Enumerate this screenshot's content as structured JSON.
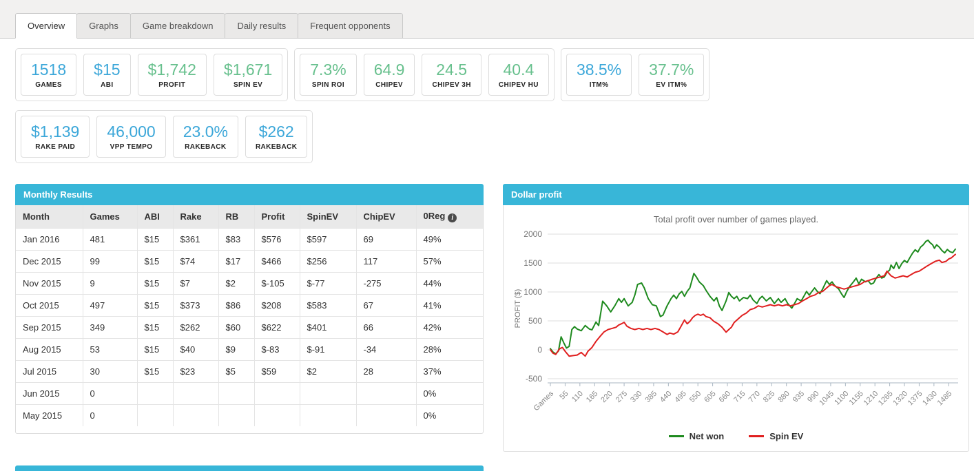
{
  "colors": {
    "accent": "#38b6d8",
    "stat_blue": "#3ca7d9",
    "stat_green": "#67c08d",
    "net_won_green": "#1e8a1e",
    "spin_ev_red": "#e01f1f"
  },
  "tabs": [
    {
      "label": "Overview",
      "active": true
    },
    {
      "label": "Graphs",
      "active": false
    },
    {
      "label": "Game breakdown",
      "active": false
    },
    {
      "label": "Daily results",
      "active": false
    },
    {
      "label": "Frequent opponents",
      "active": false
    }
  ],
  "stat_rows": [
    [
      {
        "stats": [
          {
            "value": "1518",
            "label": "GAMES",
            "color": "blue"
          },
          {
            "value": "$15",
            "label": "ABI",
            "color": "blue"
          },
          {
            "value": "$1,742",
            "label": "PROFIT",
            "color": "green"
          },
          {
            "value": "$1,671",
            "label": "SPIN EV",
            "color": "green"
          }
        ]
      },
      {
        "stats": [
          {
            "value": "7.3%",
            "label": "SPIN ROI",
            "color": "green"
          },
          {
            "value": "64.9",
            "label": "CHIPEV",
            "color": "green"
          },
          {
            "value": "24.5",
            "label": "CHIPEV 3H",
            "color": "green"
          },
          {
            "value": "40.4",
            "label": "CHIPEV HU",
            "color": "green"
          }
        ]
      },
      {
        "stats": [
          {
            "value": "38.5%",
            "label": "ITM%",
            "color": "blue"
          },
          {
            "value": "37.7%",
            "label": "EV ITM%",
            "color": "green"
          }
        ]
      }
    ],
    [
      {
        "stats": [
          {
            "value": "$1,139",
            "label": "RAKE PAID",
            "color": "blue"
          },
          {
            "value": "46,000",
            "label": "VPP TEMPO",
            "color": "blue"
          },
          {
            "value": "23.0%",
            "label": "RAKEBACK",
            "color": "blue"
          },
          {
            "value": "$262",
            "label": "RAKEBACK",
            "color": "blue"
          }
        ]
      }
    ]
  ],
  "monthly_results": {
    "title": "Monthly Results",
    "columns": [
      "Month",
      "Games",
      "ABI",
      "Rake",
      "RB",
      "Profit",
      "SpinEV",
      "ChipEV",
      "0Reg"
    ],
    "info_icon_column": "0Reg",
    "info_icon_glyph": "i",
    "rows": [
      [
        "Jan 2016",
        "481",
        "$15",
        "$361",
        "$83",
        "$576",
        "$597",
        "69",
        "49%"
      ],
      [
        "Dec 2015",
        "99",
        "$15",
        "$74",
        "$17",
        "$466",
        "$256",
        "117",
        "57%"
      ],
      [
        "Nov 2015",
        "9",
        "$15",
        "$7",
        "$2",
        "$-105",
        "$-77",
        "-275",
        "44%"
      ],
      [
        "Oct 2015",
        "497",
        "$15",
        "$373",
        "$86",
        "$208",
        "$583",
        "67",
        "41%"
      ],
      [
        "Sep 2015",
        "349",
        "$15",
        "$262",
        "$60",
        "$622",
        "$401",
        "66",
        "42%"
      ],
      [
        "Aug 2015",
        "53",
        "$15",
        "$40",
        "$9",
        "$-83",
        "$-91",
        "-34",
        "28%"
      ],
      [
        "Jul 2015",
        "30",
        "$15",
        "$23",
        "$5",
        "$59",
        "$2",
        "28",
        "37%"
      ],
      [
        "Jun 2015",
        "0",
        "",
        "",
        "",
        "",
        "",
        "",
        "0%"
      ],
      [
        "May 2015",
        "0",
        "",
        "",
        "",
        "",
        "",
        "",
        "0%"
      ]
    ]
  },
  "chart_data": {
    "type": "line",
    "title": "Dollar profit",
    "subtitle": "Total profit over number of games played.",
    "xlabel": "Games",
    "ylabel": "PROFIT ($)",
    "ylim": [
      -500,
      2000
    ],
    "xlim": [
      0,
      1510
    ],
    "grid": true,
    "legend_position": "bottom",
    "yticks": [
      2000,
      1500,
      1000,
      500,
      0,
      -500
    ],
    "xticks": [
      55,
      110,
      165,
      220,
      275,
      330,
      385,
      440,
      495,
      550,
      605,
      660,
      715,
      770,
      825,
      880,
      935,
      990,
      1045,
      1100,
      1155,
      1210,
      1265,
      1320,
      1375,
      1430,
      1485
    ],
    "series": [
      {
        "name": "Net won",
        "color": "#1e8a1e",
        "points": [
          [
            0,
            20
          ],
          [
            10,
            -40
          ],
          [
            20,
            -70
          ],
          [
            30,
            -20
          ],
          [
            40,
            225
          ],
          [
            50,
            120
          ],
          [
            60,
            30
          ],
          [
            70,
            60
          ],
          [
            80,
            350
          ],
          [
            90,
            400
          ],
          [
            100,
            360
          ],
          [
            115,
            330
          ],
          [
            130,
            420
          ],
          [
            145,
            360
          ],
          [
            155,
            345
          ],
          [
            170,
            480
          ],
          [
            180,
            420
          ],
          [
            195,
            840
          ],
          [
            210,
            760
          ],
          [
            225,
            655
          ],
          [
            240,
            760
          ],
          [
            255,
            885
          ],
          [
            265,
            820
          ],
          [
            275,
            885
          ],
          [
            290,
            760
          ],
          [
            305,
            820
          ],
          [
            315,
            950
          ],
          [
            325,
            1130
          ],
          [
            340,
            1155
          ],
          [
            350,
            1070
          ],
          [
            365,
            885
          ],
          [
            380,
            780
          ],
          [
            395,
            760
          ],
          [
            410,
            575
          ],
          [
            420,
            600
          ],
          [
            435,
            760
          ],
          [
            450,
            885
          ],
          [
            460,
            945
          ],
          [
            470,
            885
          ],
          [
            480,
            965
          ],
          [
            490,
            1010
          ],
          [
            500,
            925
          ],
          [
            510,
            1010
          ],
          [
            520,
            1070
          ],
          [
            535,
            1320
          ],
          [
            545,
            1255
          ],
          [
            555,
            1175
          ],
          [
            570,
            1110
          ],
          [
            580,
            1030
          ],
          [
            595,
            925
          ],
          [
            610,
            845
          ],
          [
            620,
            905
          ],
          [
            630,
            760
          ],
          [
            640,
            680
          ],
          [
            655,
            845
          ],
          [
            665,
            990
          ],
          [
            675,
            925
          ],
          [
            685,
            885
          ],
          [
            695,
            925
          ],
          [
            705,
            845
          ],
          [
            720,
            905
          ],
          [
            735,
            885
          ],
          [
            745,
            945
          ],
          [
            755,
            865
          ],
          [
            770,
            800
          ],
          [
            780,
            885
          ],
          [
            790,
            925
          ],
          [
            805,
            845
          ],
          [
            820,
            905
          ],
          [
            835,
            800
          ],
          [
            850,
            885
          ],
          [
            860,
            820
          ],
          [
            875,
            885
          ],
          [
            885,
            800
          ],
          [
            900,
            720
          ],
          [
            910,
            800
          ],
          [
            920,
            885
          ],
          [
            935,
            845
          ],
          [
            945,
            925
          ],
          [
            955,
            1010
          ],
          [
            965,
            945
          ],
          [
            975,
            1010
          ],
          [
            985,
            1070
          ],
          [
            995,
            1010
          ],
          [
            1005,
            970
          ],
          [
            1015,
            1050
          ],
          [
            1030,
            1195
          ],
          [
            1040,
            1130
          ],
          [
            1050,
            1175
          ],
          [
            1060,
            1110
          ],
          [
            1075,
            1050
          ],
          [
            1085,
            970
          ],
          [
            1095,
            905
          ],
          [
            1105,
            1010
          ],
          [
            1115,
            1090
          ],
          [
            1130,
            1175
          ],
          [
            1140,
            1240
          ],
          [
            1150,
            1140
          ],
          [
            1160,
            1220
          ],
          [
            1175,
            1175
          ],
          [
            1185,
            1195
          ],
          [
            1195,
            1135
          ],
          [
            1205,
            1155
          ],
          [
            1215,
            1240
          ],
          [
            1225,
            1300
          ],
          [
            1235,
            1240
          ],
          [
            1245,
            1260
          ],
          [
            1255,
            1340
          ],
          [
            1265,
            1380
          ],
          [
            1270,
            1465
          ],
          [
            1280,
            1405
          ],
          [
            1290,
            1510
          ],
          [
            1300,
            1405
          ],
          [
            1310,
            1490
          ],
          [
            1320,
            1545
          ],
          [
            1330,
            1510
          ],
          [
            1340,
            1590
          ],
          [
            1350,
            1670
          ],
          [
            1360,
            1730
          ],
          [
            1370,
            1690
          ],
          [
            1380,
            1775
          ],
          [
            1390,
            1815
          ],
          [
            1400,
            1875
          ],
          [
            1408,
            1895
          ],
          [
            1415,
            1855
          ],
          [
            1425,
            1815
          ],
          [
            1432,
            1755
          ],
          [
            1440,
            1815
          ],
          [
            1450,
            1775
          ],
          [
            1460,
            1715
          ],
          [
            1470,
            1675
          ],
          [
            1480,
            1735
          ],
          [
            1490,
            1695
          ],
          [
            1500,
            1680
          ],
          [
            1510,
            1740
          ]
        ]
      },
      {
        "name": "Spin EV",
        "color": "#e01f1f",
        "points": [
          [
            0,
            0
          ],
          [
            10,
            -60
          ],
          [
            20,
            -80
          ],
          [
            35,
            20
          ],
          [
            45,
            40
          ],
          [
            55,
            -25
          ],
          [
            70,
            -110
          ],
          [
            85,
            -100
          ],
          [
            100,
            -90
          ],
          [
            115,
            -45
          ],
          [
            130,
            -110
          ],
          [
            140,
            -25
          ],
          [
            155,
            40
          ],
          [
            170,
            145
          ],
          [
            185,
            230
          ],
          [
            200,
            310
          ],
          [
            215,
            350
          ],
          [
            230,
            370
          ],
          [
            245,
            390
          ],
          [
            255,
            430
          ],
          [
            265,
            450
          ],
          [
            275,
            475
          ],
          [
            285,
            410
          ],
          [
            300,
            370
          ],
          [
            315,
            350
          ],
          [
            330,
            370
          ],
          [
            345,
            350
          ],
          [
            360,
            370
          ],
          [
            375,
            350
          ],
          [
            390,
            370
          ],
          [
            405,
            350
          ],
          [
            420,
            310
          ],
          [
            435,
            265
          ],
          [
            445,
            290
          ],
          [
            460,
            270
          ],
          [
            475,
            310
          ],
          [
            485,
            390
          ],
          [
            500,
            515
          ],
          [
            510,
            450
          ],
          [
            520,
            490
          ],
          [
            530,
            555
          ],
          [
            540,
            595
          ],
          [
            550,
            615
          ],
          [
            560,
            595
          ],
          [
            570,
            615
          ],
          [
            580,
            575
          ],
          [
            595,
            555
          ],
          [
            610,
            490
          ],
          [
            625,
            450
          ],
          [
            640,
            390
          ],
          [
            655,
            305
          ],
          [
            665,
            350
          ],
          [
            675,
            390
          ],
          [
            685,
            470
          ],
          [
            700,
            535
          ],
          [
            715,
            595
          ],
          [
            730,
            635
          ],
          [
            745,
            695
          ],
          [
            760,
            715
          ],
          [
            775,
            760
          ],
          [
            790,
            740
          ],
          [
            805,
            760
          ],
          [
            820,
            780
          ],
          [
            835,
            760
          ],
          [
            850,
            780
          ],
          [
            865,
            760
          ],
          [
            880,
            780
          ],
          [
            895,
            760
          ],
          [
            910,
            780
          ],
          [
            925,
            800
          ],
          [
            940,
            845
          ],
          [
            955,
            885
          ],
          [
            970,
            925
          ],
          [
            985,
            945
          ],
          [
            1000,
            990
          ],
          [
            1015,
            1010
          ],
          [
            1030,
            1070
          ],
          [
            1040,
            1110
          ],
          [
            1050,
            1130
          ],
          [
            1065,
            1090
          ],
          [
            1080,
            1070
          ],
          [
            1095,
            1050
          ],
          [
            1110,
            1070
          ],
          [
            1125,
            1090
          ],
          [
            1140,
            1110
          ],
          [
            1155,
            1130
          ],
          [
            1170,
            1175
          ],
          [
            1185,
            1195
          ],
          [
            1200,
            1220
          ],
          [
            1215,
            1240
          ],
          [
            1230,
            1260
          ],
          [
            1245,
            1280
          ],
          [
            1255,
            1360
          ],
          [
            1270,
            1280
          ],
          [
            1285,
            1240
          ],
          [
            1300,
            1260
          ],
          [
            1315,
            1280
          ],
          [
            1330,
            1260
          ],
          [
            1345,
            1300
          ],
          [
            1360,
            1340
          ],
          [
            1375,
            1360
          ],
          [
            1390,
            1405
          ],
          [
            1405,
            1450
          ],
          [
            1420,
            1490
          ],
          [
            1435,
            1530
          ],
          [
            1450,
            1550
          ],
          [
            1460,
            1510
          ],
          [
            1475,
            1530
          ],
          [
            1485,
            1570
          ],
          [
            1495,
            1590
          ],
          [
            1510,
            1650
          ]
        ]
      }
    ]
  }
}
